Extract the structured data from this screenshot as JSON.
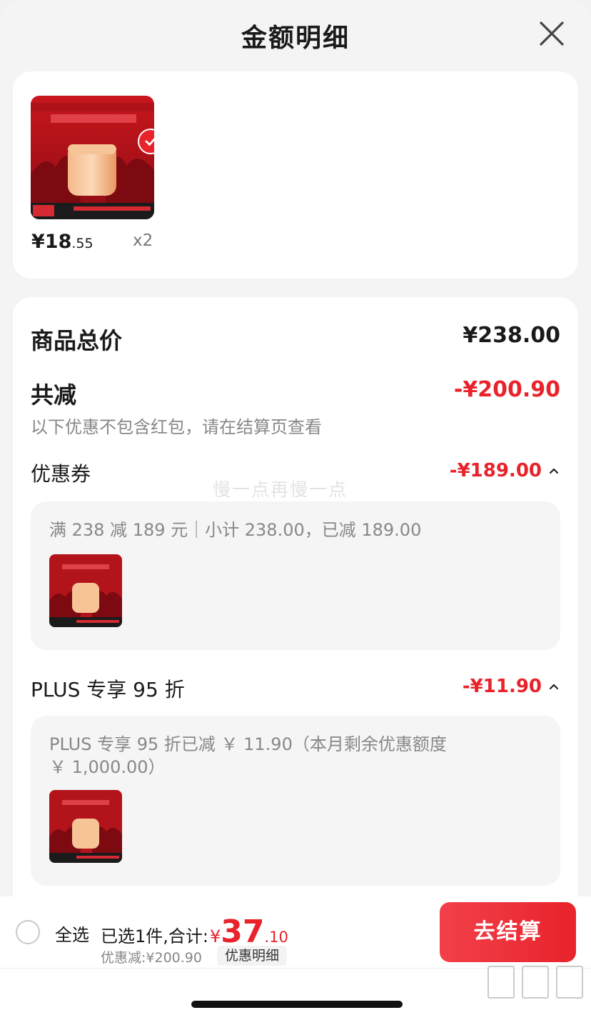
{
  "header": {
    "title": "金额明细"
  },
  "product": {
    "price_prefix": "¥18",
    "price_decimal": ".55",
    "quantity": "x2"
  },
  "detail": {
    "total_label": "商品总价",
    "total_value": "¥238.00",
    "reduce_label": "共减",
    "reduce_value": "-¥200.90",
    "reduce_note": "以下优惠不包含红包，请在结算页查看",
    "coupon_label": "优惠券",
    "coupon_value": "-¥189.00",
    "coupon_text": "满 238 减 189 元｜小计 238.00，已减 189.00",
    "plus_label": "PLUS 专享 95 折",
    "plus_value": "-¥11.90",
    "plus_text": "PLUS 专享 95 折已减 ￥ 11.90（本月剩余优惠额度 ￥ 1,000.00）"
  },
  "watermark": "慢一点再慢一点",
  "bottom": {
    "select_all": "全选",
    "selected_summary": "已选1件,合计:",
    "total_currency": "¥",
    "total_int": "37",
    "total_dec": ".10",
    "discount": "优惠减:¥200.90",
    "detail_button": "优惠明细",
    "checkout": "去结算"
  },
  "colors": {
    "accent": "#e8232b",
    "background": "#f4f4f4"
  },
  "icons": {
    "close": "close-icon",
    "check": "check-icon",
    "caret": "chevron-up-icon"
  }
}
